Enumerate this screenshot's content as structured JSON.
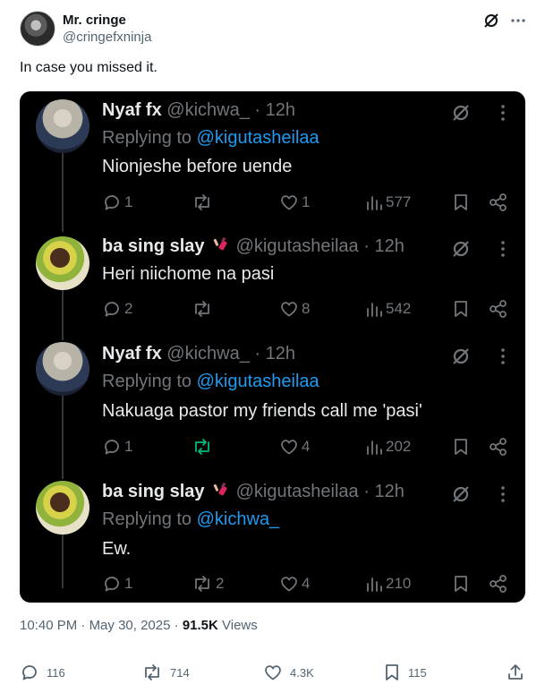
{
  "author": {
    "name": "Mr. cringe",
    "handle": "@cringefxninja"
  },
  "tweet": {
    "text": "In case you missed it."
  },
  "replies": [
    {
      "name": "Nyaf fx",
      "handle": "@kichwa_",
      "time": "· 12h",
      "replying_prefix": "Replying to ",
      "replying_to": "@kigutasheilaa",
      "text": "Nionjeshe before uende",
      "counts": {
        "reply": "1",
        "repost": "",
        "like": "1",
        "views": "577"
      }
    },
    {
      "name": "ba sing slay",
      "handle": "@kigutasheilaa",
      "time": "· 12h",
      "text": "Heri niichome na pasi",
      "counts": {
        "reply": "2",
        "repost": "",
        "like": "8",
        "views": "542"
      }
    },
    {
      "name": "Nyaf fx",
      "handle": "@kichwa_",
      "time": "· 12h",
      "replying_prefix": "Replying to ",
      "replying_to": "@kigutasheilaa",
      "text": "Nakuaga pastor my friends call me 'pasi'",
      "counts": {
        "reply": "1",
        "repost": "",
        "like": "4",
        "views": "202"
      }
    },
    {
      "name": "ba sing slay",
      "handle": "@kigutasheilaa",
      "time": "· 12h",
      "replying_prefix": "Replying to ",
      "replying_to": "@kichwa_",
      "text": "Ew.",
      "counts": {
        "reply": "1",
        "repost": "2",
        "like": "4",
        "views": "210"
      }
    }
  ],
  "meta": {
    "time": "10:40 PM",
    "sep1": " · ",
    "date": "May 30, 2025",
    "sep2": " · ",
    "views_count": "91.5K",
    "views_label": " Views"
  },
  "stats": {
    "replies": "116",
    "reposts": "714",
    "likes": "4.3K",
    "bookmarks": "115"
  },
  "colors": {
    "accent": "#1d9bf0",
    "repost_active": "#00ba7c",
    "card_bg": "#000000"
  }
}
